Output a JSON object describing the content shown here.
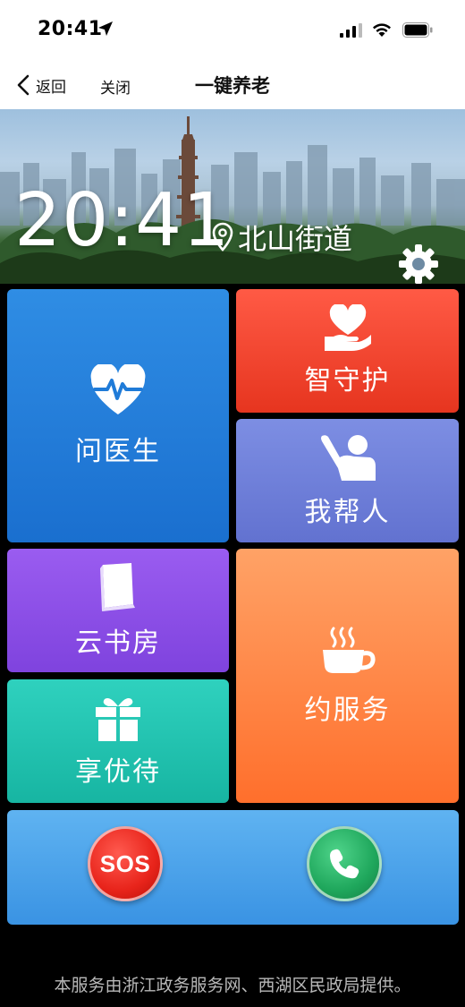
{
  "status_bar": {
    "time": "20:41",
    "icons": [
      "location-arrow-icon",
      "cellular-signal-icon",
      "wifi-icon",
      "battery-icon"
    ]
  },
  "nav": {
    "back_label": "返回",
    "close_label": "关闭",
    "title": "一键养老"
  },
  "hero": {
    "clock": "20:41",
    "location": "北山街道",
    "icons": [
      "location-pin-icon",
      "gear-icon"
    ]
  },
  "tiles": {
    "doctor": {
      "label": "问医生",
      "icon": "heartbeat-icon",
      "color": "#1f7bd8"
    },
    "guard": {
      "label": "智守护",
      "icon": "heart-hand-icon",
      "color": "#f0442e"
    },
    "help": {
      "label": "我帮人",
      "icon": "volunteer-icon",
      "color": "#6e7ed8"
    },
    "books": {
      "label": "云书房",
      "icon": "book-icon",
      "color": "#8a4fe6"
    },
    "service": {
      "label": "约服务",
      "icon": "coffee-cup-icon",
      "color": "#ff8040"
    },
    "perks": {
      "label": "享优待",
      "icon": "gift-icon",
      "color": "#22c3af"
    }
  },
  "bottom": {
    "sos_label": "SOS",
    "call_icon": "phone-icon",
    "sos_color": "#e8241b",
    "call_color": "#1fa75c"
  },
  "footer": {
    "text": "本服务由浙江政务服务网、西湖区民政局提供。"
  }
}
